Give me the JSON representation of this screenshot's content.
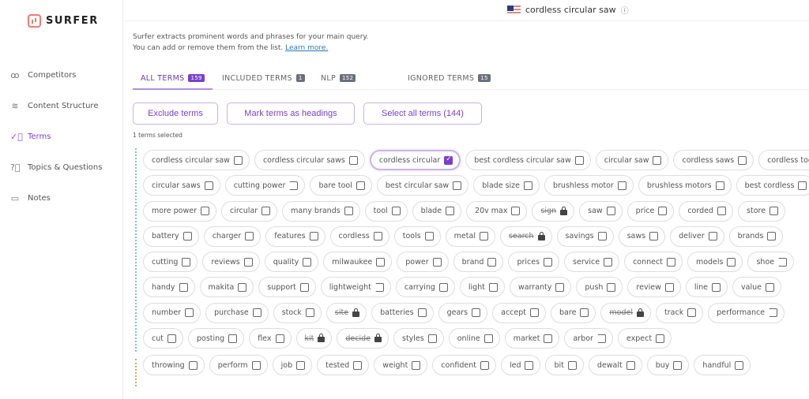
{
  "sidebar": {
    "logo": "SURFER",
    "items": [
      {
        "label": "Competitors",
        "icon": "users-icon",
        "active": false
      },
      {
        "label": "Content Structure",
        "icon": "layers-icon",
        "active": false
      },
      {
        "label": "Terms",
        "icon": "check-circle-icon",
        "active": true
      },
      {
        "label": "Topics & Questions",
        "icon": "question-circle-icon",
        "active": false
      },
      {
        "label": "Notes",
        "icon": "message-icon",
        "active": false
      }
    ]
  },
  "header": {
    "query": "cordless circular saw",
    "flag": "us-flag-icon"
  },
  "intro": {
    "line1": "Surfer extracts prominent words and phrases for your main query.",
    "line2": "You can add or remove them from the list.",
    "link": "Learn more."
  },
  "tabs": [
    {
      "label": "ALL TERMS",
      "count": "159",
      "active": true
    },
    {
      "label": "INCLUDED TERMS",
      "count": "1"
    },
    {
      "label": "NLP",
      "count": "152"
    },
    {
      "label": "IGNORED TERMS",
      "count": "15"
    }
  ],
  "actions": {
    "exclude": "Exclude terms",
    "headings": "Mark terms as headings",
    "select_all": "Select all terms (144)"
  },
  "selected_count": "1 terms selected",
  "accent": "#7b3fd0",
  "term_rows": [
    [
      {
        "t": "cordless circular saw"
      },
      {
        "t": "cordless circular saws"
      },
      {
        "t": "cordless circular",
        "checked": true
      },
      {
        "t": "best cordless circular saw"
      },
      {
        "t": "circular saw"
      },
      {
        "t": "cordless saws"
      },
      {
        "t": "cordless tool"
      }
    ],
    [
      {
        "t": "circular saws"
      },
      {
        "t": "cutting power",
        "partial": true
      },
      {
        "t": "bare tool"
      },
      {
        "t": "best circular saw"
      },
      {
        "t": "blade size"
      },
      {
        "t": "brushless motor"
      },
      {
        "t": "brushless motors"
      },
      {
        "t": "best cordless"
      }
    ],
    [
      {
        "t": "more power"
      },
      {
        "t": "circular"
      },
      {
        "t": "many brands"
      },
      {
        "t": "tool"
      },
      {
        "t": "blade"
      },
      {
        "t": "20v max"
      },
      {
        "t": "sign",
        "locked": true
      },
      {
        "t": "saw"
      },
      {
        "t": "price"
      },
      {
        "t": "corded"
      },
      {
        "t": "store"
      }
    ],
    [
      {
        "t": "battery"
      },
      {
        "t": "charger"
      },
      {
        "t": "features"
      },
      {
        "t": "cordless"
      },
      {
        "t": "tools"
      },
      {
        "t": "metal"
      },
      {
        "t": "search",
        "locked": true
      },
      {
        "t": "savings"
      },
      {
        "t": "saws"
      },
      {
        "t": "deliver"
      },
      {
        "t": "brands"
      }
    ],
    [
      {
        "t": "cutting"
      },
      {
        "t": "reviews"
      },
      {
        "t": "quality"
      },
      {
        "t": "milwaukee"
      },
      {
        "t": "power"
      },
      {
        "t": "brand"
      },
      {
        "t": "prices"
      },
      {
        "t": "service"
      },
      {
        "t": "connect"
      },
      {
        "t": "models"
      },
      {
        "t": "shoe",
        "partial": true
      }
    ],
    [
      {
        "t": "handy"
      },
      {
        "t": "makita"
      },
      {
        "t": "support"
      },
      {
        "t": "lightweight",
        "partial": true
      },
      {
        "t": "carrying"
      },
      {
        "t": "light"
      },
      {
        "t": "warranty"
      },
      {
        "t": "push"
      },
      {
        "t": "review"
      },
      {
        "t": "line"
      },
      {
        "t": "value"
      }
    ],
    [
      {
        "t": "number"
      },
      {
        "t": "purchase"
      },
      {
        "t": "stock"
      },
      {
        "t": "site",
        "locked": true
      },
      {
        "t": "batteries"
      },
      {
        "t": "gears"
      },
      {
        "t": "accept"
      },
      {
        "t": "bare"
      },
      {
        "t": "model",
        "locked": true
      },
      {
        "t": "track"
      },
      {
        "t": "performance",
        "partial": true
      }
    ],
    [
      {
        "t": "cut"
      },
      {
        "t": "posting"
      },
      {
        "t": "flex"
      },
      {
        "t": "kit",
        "locked": true
      },
      {
        "t": "decide",
        "locked": true
      },
      {
        "t": "styles"
      },
      {
        "t": "online"
      },
      {
        "t": "market"
      },
      {
        "t": "arbor",
        "partial": true
      },
      {
        "t": "expect"
      }
    ],
    [
      {
        "t": "throwing"
      },
      {
        "t": "perform"
      },
      {
        "t": "job"
      },
      {
        "t": "tested"
      },
      {
        "t": "weight"
      },
      {
        "t": "confident"
      },
      {
        "t": "led"
      },
      {
        "t": "bit"
      },
      {
        "t": "dewalt"
      },
      {
        "t": "buy"
      },
      {
        "t": "handful"
      }
    ]
  ]
}
